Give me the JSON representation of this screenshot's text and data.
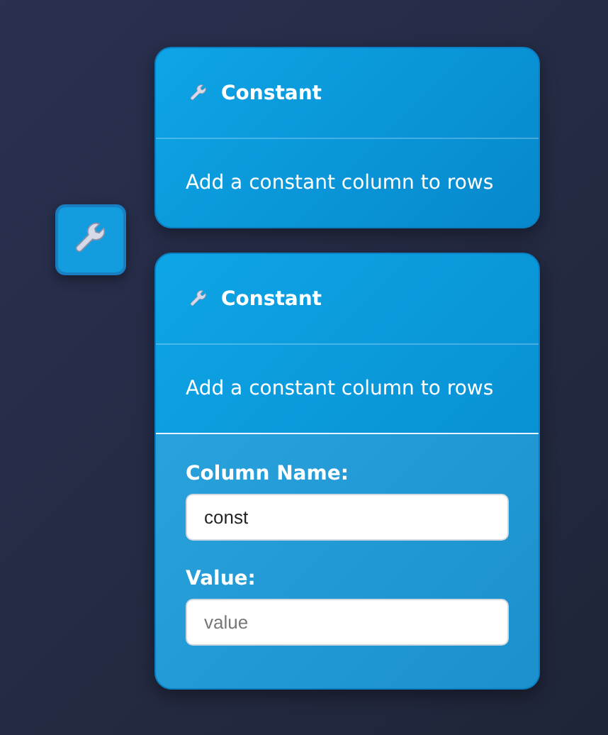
{
  "cards": [
    {
      "title": "Constant",
      "description": "Add a constant column to rows"
    },
    {
      "title": "Constant",
      "description": "Add a constant column to rows",
      "fields": [
        {
          "label": "Column Name:",
          "value": "const"
        },
        {
          "label": "Value:",
          "placeholder": "value"
        }
      ]
    }
  ]
}
